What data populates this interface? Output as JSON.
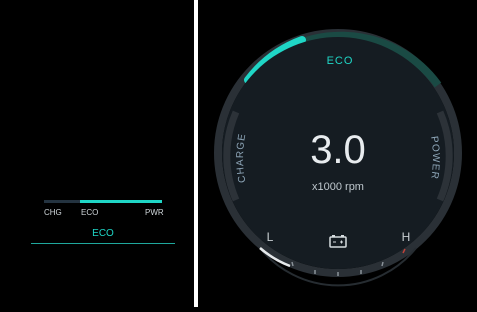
{
  "mini_cluster": {
    "labels": {
      "chg": "CHG",
      "eco": "ECO",
      "pwr": "PWR"
    },
    "mode": "ECO"
  },
  "gauge": {
    "mode_label": "ECO",
    "left_label": "CHARGE",
    "right_label": "POWER",
    "value": "3.0",
    "unit": "x1000 rpm",
    "low_label": "L",
    "high_label": "H",
    "battery_icon": "battery-icon",
    "colors": {
      "accent": "#1fd6c6",
      "eco_arc": "#1a4a44",
      "ring": "#2a3036",
      "face": "#151c22"
    }
  }
}
